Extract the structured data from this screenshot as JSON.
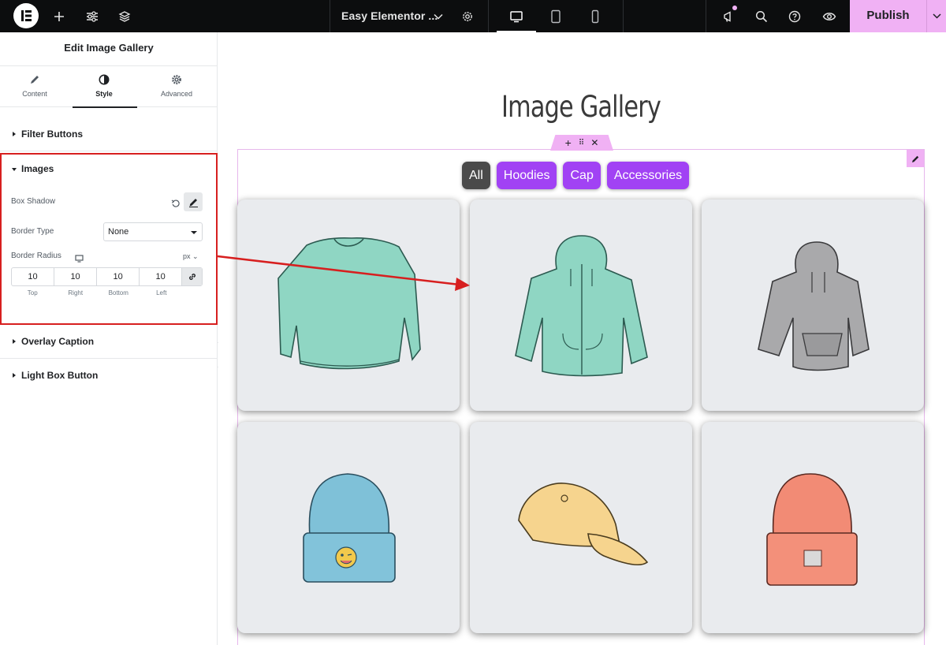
{
  "topbar": {
    "document_title": "Easy Elementor ...",
    "publish_label": "Publish",
    "icons": [
      "elementor-logo-icon",
      "plus-icon",
      "sliders-icon",
      "layers-icon",
      "chevron-down-icon",
      "gear-icon",
      "desktop-icon",
      "tablet-icon",
      "mobile-icon",
      "megaphone-icon",
      "search-icon",
      "help-icon",
      "eye-icon"
    ],
    "accent_color": "#f0b1f4"
  },
  "panel": {
    "title": "Edit Image Gallery",
    "tabs": [
      {
        "label": "Content",
        "icon": "pencil-icon"
      },
      {
        "label": "Style",
        "icon": "contrast-icon"
      },
      {
        "label": "Advanced",
        "icon": "gear-icon"
      }
    ],
    "sections": {
      "filter_buttons": "Filter Buttons",
      "images": "Images",
      "overlay_caption": "Overlay Caption",
      "light_box_button": "Light Box Button"
    },
    "controls": {
      "box_shadow_label": "Box Shadow",
      "border_type_label": "Border Type",
      "border_type_value": "None",
      "border_radius_label": "Border Radius",
      "unit": "px",
      "radius": {
        "top": "10",
        "right": "10",
        "bottom": "10",
        "left": "10"
      },
      "radius_labels": {
        "top": "Top",
        "right": "Right",
        "bottom": "Bottom",
        "left": "Left"
      }
    }
  },
  "canvas": {
    "title": "Image Gallery",
    "filters": [
      "All",
      "Hoodies",
      "Cap",
      "Accessories"
    ],
    "active_filter": "All",
    "filter_color": "#a142f4",
    "active_filter_color": "#4a4a4a",
    "gallery": [
      {
        "item": "green-sweater"
      },
      {
        "item": "green-zip-hoodie"
      },
      {
        "item": "grey-hoodie"
      },
      {
        "item": "blue-beanie"
      },
      {
        "item": "yellow-cap"
      },
      {
        "item": "red-beanie"
      }
    ]
  },
  "annotation_color": "#d71f1f"
}
